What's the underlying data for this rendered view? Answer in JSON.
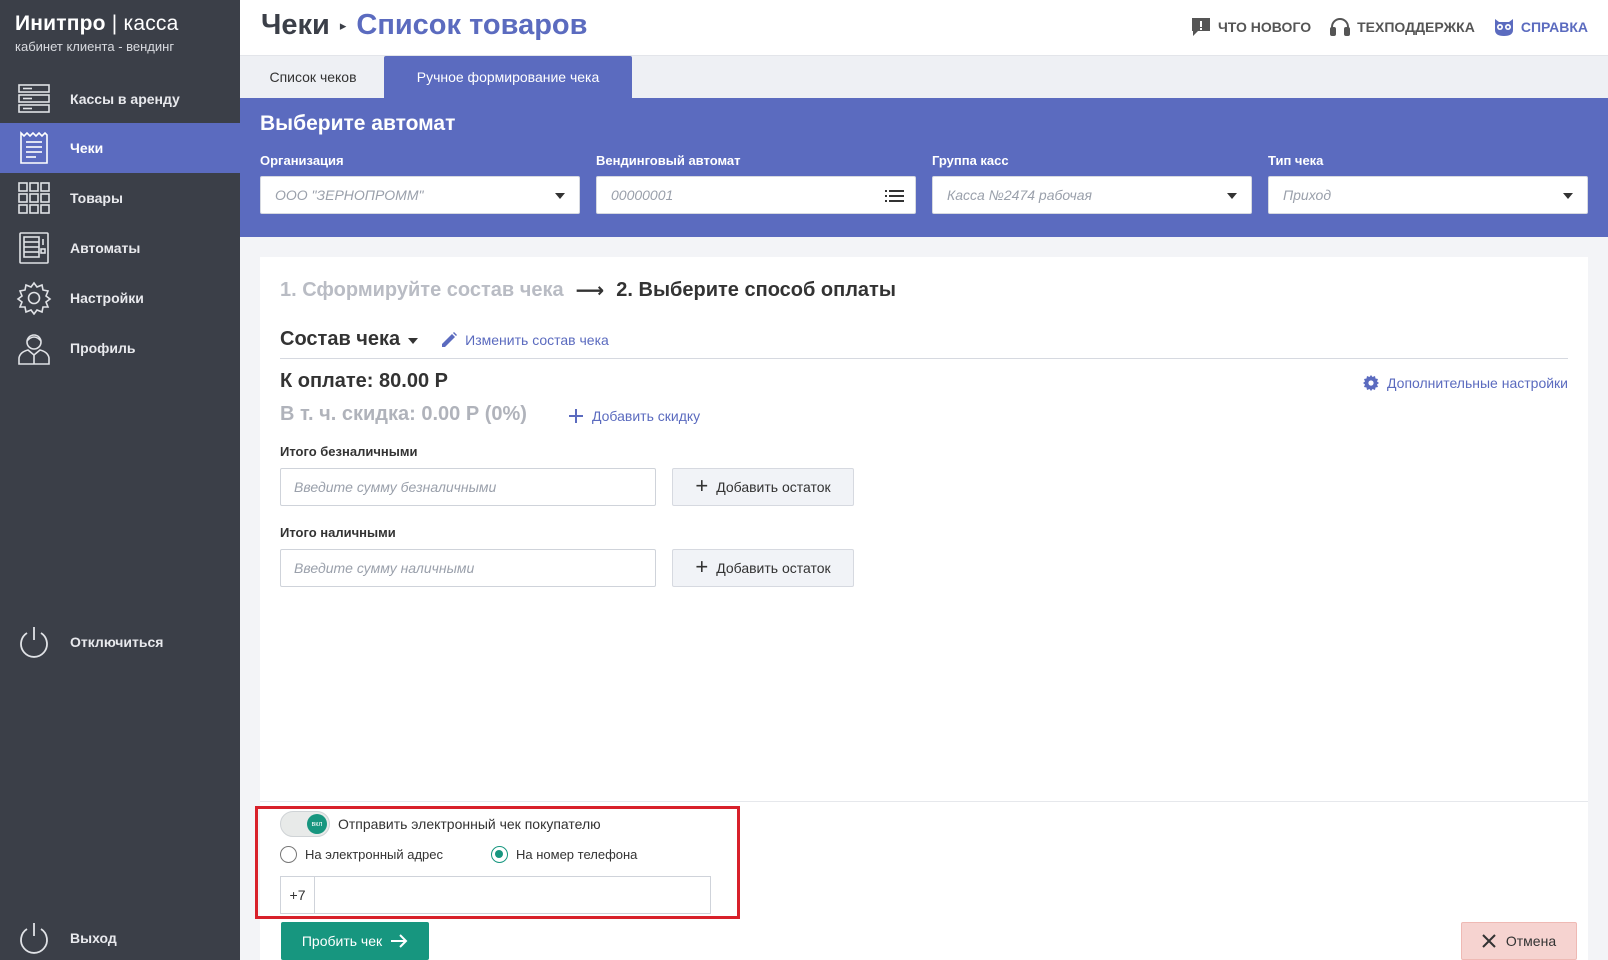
{
  "brand": {
    "name_bold": "Инитпро",
    "separator": "|",
    "name_thin": "касса",
    "subtitle": "кабинет клиента - вендинг"
  },
  "sidebar": {
    "items": [
      {
        "label": "Кассы в аренду",
        "icon": "server-icon",
        "active": false
      },
      {
        "label": "Чеки",
        "icon": "receipt-icon",
        "active": true
      },
      {
        "label": "Товары",
        "icon": "grid-icon",
        "active": false
      },
      {
        "label": "Автоматы",
        "icon": "vending-machine-icon",
        "active": false
      },
      {
        "label": "Настройки",
        "icon": "gear-icon",
        "active": false
      },
      {
        "label": "Профиль",
        "icon": "user-icon",
        "active": false
      }
    ],
    "disconnect": "Отключиться",
    "logout": "Выход"
  },
  "header": {
    "breadcrumb_root": "Чеки",
    "breadcrumb_current": "Список товаров",
    "links": {
      "whats_new": "ЧТО НОВОГО",
      "support": "ТЕХПОДДЕРЖКА",
      "help": "СПРАВКА"
    }
  },
  "tabs": [
    {
      "label": "Список чеков",
      "active": false
    },
    {
      "label": "Ручное формирование чека",
      "active": true
    }
  ],
  "selector": {
    "title": "Выберите автомат",
    "fields": [
      {
        "label": "Организация",
        "value": "ООО \"ЗЕРНОПРОММ\""
      },
      {
        "label": "Вендинговый автомат",
        "value": "00000001"
      },
      {
        "label": "Группа касс",
        "value": "Касса №2474 рабочая"
      },
      {
        "label": "Тип чека",
        "value": "Приход"
      }
    ]
  },
  "steps": {
    "step1": "1. Сформируйте состав чека",
    "arrow": "⟶",
    "step2": "2. Выберите способ оплаты"
  },
  "composition": {
    "title": "Состав чека",
    "edit_link": "Изменить состав чека"
  },
  "payment": {
    "to_pay": "К оплате: 80.00 Р",
    "discount": "В т. ч. скидка: 0.00 Р (0%)",
    "add_discount": "Добавить скидку",
    "extra_settings": "Дополнительные настройки",
    "cashless_label": "Итого безналичными",
    "cashless_placeholder": "Введите сумму безналичными",
    "cash_label": "Итого наличными",
    "cash_placeholder": "Введите сумму наличными",
    "add_remainder": "Добавить остаток"
  },
  "receipt": {
    "toggle_text": "вкл",
    "send_label": "Отправить электронный чек покупателю",
    "option_email": "На электронный адрес",
    "option_phone": "На номер телефона",
    "phone_prefix": "+7",
    "phone_value": ""
  },
  "actions": {
    "submit": "Пробить чек",
    "cancel": "Отмена"
  },
  "colors": {
    "sidebar": "#3b3f48",
    "accent": "#5b6bbf",
    "primary_button": "#17967f",
    "cancel_button": "#f6d3d0",
    "highlight_box": "#d8202a"
  }
}
